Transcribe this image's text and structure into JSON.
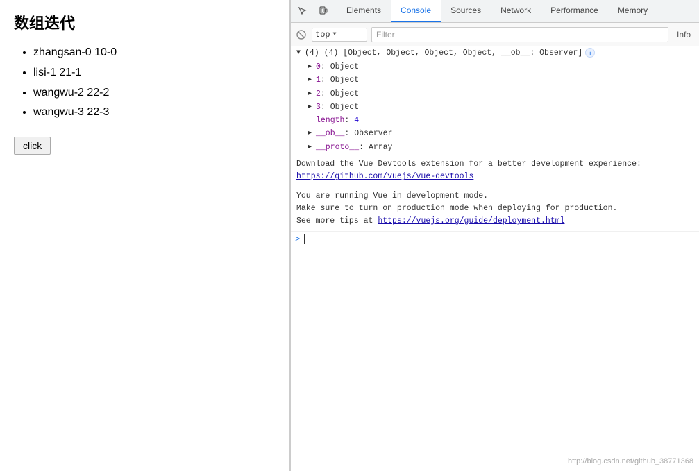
{
  "leftPanel": {
    "title": "数组迭代",
    "listItems": [
      "zhangsan-0 10-0",
      "lisi-1 21-1",
      "wangwu-2 22-2",
      "wangwu-3 22-3"
    ],
    "buttonLabel": "click"
  },
  "devtools": {
    "tabs": [
      {
        "label": "Elements",
        "active": false
      },
      {
        "label": "Console",
        "active": true
      },
      {
        "label": "Sources",
        "active": false
      },
      {
        "label": "Network",
        "active": false
      },
      {
        "label": "Performance",
        "active": false
      },
      {
        "label": "Memory",
        "active": false
      }
    ],
    "consoleBar": {
      "topValue": "top",
      "filterPlaceholder": "Filter",
      "infoLabel": "Info"
    },
    "consoleContent": {
      "arrayHeader": "(4) [Object, Object, Object, Object, __ob__: Observer]",
      "treeItems": [
        {
          "indent": 1,
          "toggle": "▶",
          "key": "0",
          "value": "Object"
        },
        {
          "indent": 1,
          "toggle": "▶",
          "key": "1",
          "value": "Object"
        },
        {
          "indent": 1,
          "toggle": "▶",
          "key": "2",
          "value": "Object"
        },
        {
          "indent": 1,
          "toggle": "▶",
          "key": "3",
          "value": "Object"
        },
        {
          "indent": 1,
          "toggle": "",
          "key": "length",
          "value": "4",
          "isNum": true
        },
        {
          "indent": 1,
          "toggle": "▶",
          "key": "__ob__",
          "value": "Observer"
        },
        {
          "indent": 1,
          "toggle": "▶",
          "key": "__proto__",
          "value": "Array"
        }
      ],
      "messages": [
        {
          "text": "Download the Vue Devtools extension for a better development experience:",
          "linkText": "https://github.com/vuejs/vue-devtools",
          "linkHref": "https://github.com/vuejs/vue-devtools"
        },
        {
          "lines": [
            "You are running Vue in development mode.",
            "Make sure to turn on production mode when deploying for production.",
            "See more tips at "
          ],
          "linkText": "https://vuejs.org/guide/deployment.html",
          "linkHref": "https://vuejs.org/guide/deployment.html"
        }
      ],
      "promptSymbol": ">"
    }
  },
  "watermark": "http://blog.csdn.net/github_38771368"
}
